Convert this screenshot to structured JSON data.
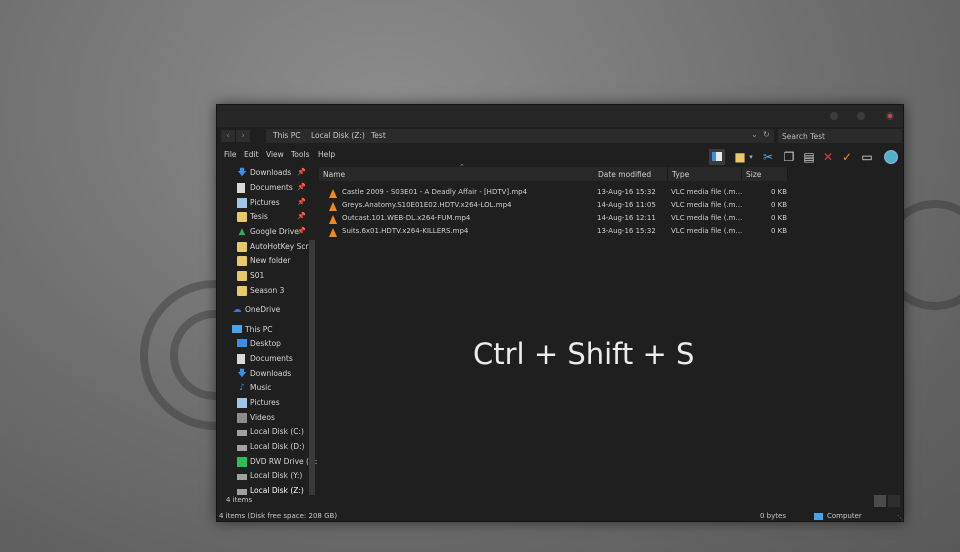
{
  "window": {
    "breadcrumb": [
      "This PC",
      "Local Disk (Z:)",
      "Test"
    ],
    "search_placeholder": "Search Test",
    "address_controls": {
      "dropdown": "⌄",
      "refresh": "↻"
    }
  },
  "menu": [
    "File",
    "Edit",
    "View",
    "Tools",
    "Help"
  ],
  "toolbar_icons": [
    "preview-pane-icon",
    "new-folder-icon",
    "cut-icon",
    "copy-icon",
    "paste-icon",
    "delete-icon",
    "check-icon",
    "rename-icon",
    "globe-icon"
  ],
  "sidebar": {
    "quick_access": [
      {
        "label": "Downloads",
        "icon": "download-arrow-icon",
        "pinned": true
      },
      {
        "label": "Documents",
        "icon": "document-icon",
        "pinned": true
      },
      {
        "label": "Pictures",
        "icon": "pictures-icon",
        "pinned": true
      },
      {
        "label": "Tesis",
        "icon": "folder-icon",
        "pinned": true
      },
      {
        "label": "Google Drive",
        "icon": "google-drive-icon",
        "pinned": true
      },
      {
        "label": "AutoHotKey Scrip",
        "icon": "folder-icon",
        "pinned": false
      },
      {
        "label": "New folder",
        "icon": "folder-icon",
        "pinned": false
      },
      {
        "label": "S01",
        "icon": "folder-icon",
        "pinned": false
      },
      {
        "label": "Season 3",
        "icon": "folder-icon",
        "pinned": false
      }
    ],
    "onedrive": "OneDrive",
    "this_pc": "This PC",
    "this_pc_items": [
      {
        "label": "Desktop",
        "icon": "desktop-icon"
      },
      {
        "label": "Documents",
        "icon": "document-icon"
      },
      {
        "label": "Downloads",
        "icon": "download-arrow-icon"
      },
      {
        "label": "Music",
        "icon": "music-icon"
      },
      {
        "label": "Pictures",
        "icon": "pictures-icon"
      },
      {
        "label": "Videos",
        "icon": "videos-icon"
      },
      {
        "label": "Local Disk (C:)",
        "icon": "drive-icon"
      },
      {
        "label": "Local Disk (D:)",
        "icon": "drive-icon"
      },
      {
        "label": "DVD RW Drive (G:",
        "icon": "dvd-icon"
      },
      {
        "label": "Local Disk (Y:)",
        "icon": "drive-icon"
      },
      {
        "label": "Local Disk (Z:)",
        "icon": "drive-icon"
      }
    ]
  },
  "columns": [
    "Name",
    "Date modified",
    "Type",
    "Size"
  ],
  "files": [
    {
      "name": "Castle 2009 - S03E01 - A Deadly Affair - [HDTV].mp4",
      "date": "13-Aug-16 15:32",
      "type": "VLC media file (.m...",
      "size": "0 KB"
    },
    {
      "name": "Greys.Anatomy.S10E01E02.HDTV.x264-LOL.mp4",
      "date": "14-Aug-16 11:05",
      "type": "VLC media file (.m...",
      "size": "0 KB"
    },
    {
      "name": "Outcast.101.WEB-DL.x264-FUM.mp4",
      "date": "14-Aug-16 12:11",
      "type": "VLC media file (.m...",
      "size": "0 KB"
    },
    {
      "name": "Suits.6x01.HDTV.x264-KILLERS.mp4",
      "date": "13-Aug-16 15:32",
      "type": "VLC media file (.m...",
      "size": "0 KB"
    }
  ],
  "overlay": "Ctrl + Shift + S",
  "status": {
    "item_count": "4 items",
    "disk_info": "4 items (Disk free space: 208 GB)",
    "size": "0 bytes",
    "location": "Computer"
  },
  "colors": {
    "vlc_orange": "#f08a1c",
    "folder_yellow": "#e7c96b",
    "accent_blue": "#3a8ee6"
  }
}
